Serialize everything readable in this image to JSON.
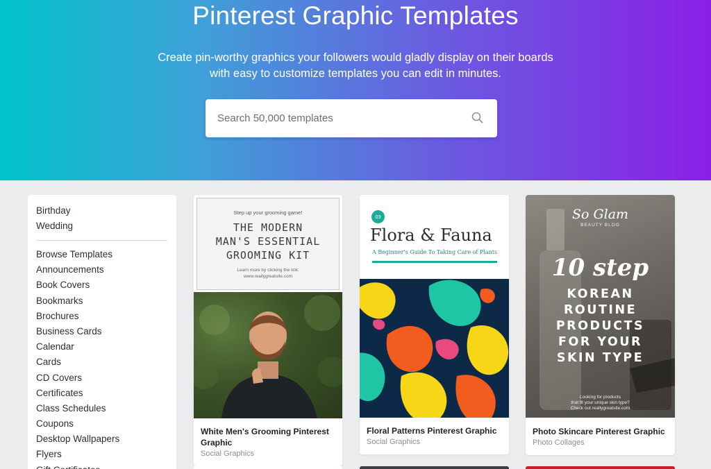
{
  "hero": {
    "title": "Pinterest Graphic Templates",
    "subtitle_line1": "Create pin-worthy graphics your followers would gladly display on their boards",
    "subtitle_line2": "with easy to customize templates you can edit in minutes."
  },
  "search": {
    "placeholder": "Search 50,000 templates",
    "icon": "search-icon"
  },
  "sidebar": {
    "top_items": [
      "Birthday",
      "Wedding"
    ],
    "items": [
      "Browse Templates",
      "Announcements",
      "Book Covers",
      "Bookmarks",
      "Brochures",
      "Business Cards",
      "Calendar",
      "Cards",
      "CD Covers",
      "Certificates",
      "Class Schedules",
      "Coupons",
      "Desktop Wallpapers",
      "Flyers",
      "Gift Certificates"
    ]
  },
  "cards": [
    {
      "title": "White Men's Grooming Pinterest Graphic",
      "category": "Social Graphics",
      "preview": {
        "tagline": "Step up your grooming game!",
        "headline": [
          "THE MODERN",
          "MAN'S ESSENTIAL",
          "GROOMING KIT"
        ],
        "footer_line1": "Learn more by clicking the link:",
        "footer_line2": "www.reallygreatsite.com"
      }
    },
    {
      "title": "Floral Patterns Pinterest Graphic",
      "category": "Social Graphics",
      "preview": {
        "badge": "03",
        "headline": "Flora & Fauna",
        "subheadline": "A Beginner's Guide To Taking Care of Plants"
      }
    },
    {
      "title": "Photo Skincare Pinterest Graphic",
      "category": "Photo Collages",
      "preview": {
        "brand": "So Glam",
        "brand_sub": "BEAUTY BLOG",
        "headline": "10 step",
        "body": [
          "KOREAN",
          "ROUTINE",
          "PRODUCTS",
          "FOR YOUR",
          "SKIN TYPE"
        ],
        "small_line1": "Looking for products",
        "small_line2": "that fit your unique skin type?",
        "small_line3": "Check out reallygreatsite.com"
      }
    }
  ],
  "colors": {
    "hero_gradient_start": "#00c4cc",
    "hero_gradient_end": "#8a1fe6",
    "teal_accent": "#1bab9a",
    "page_bg": "#ebecee"
  }
}
